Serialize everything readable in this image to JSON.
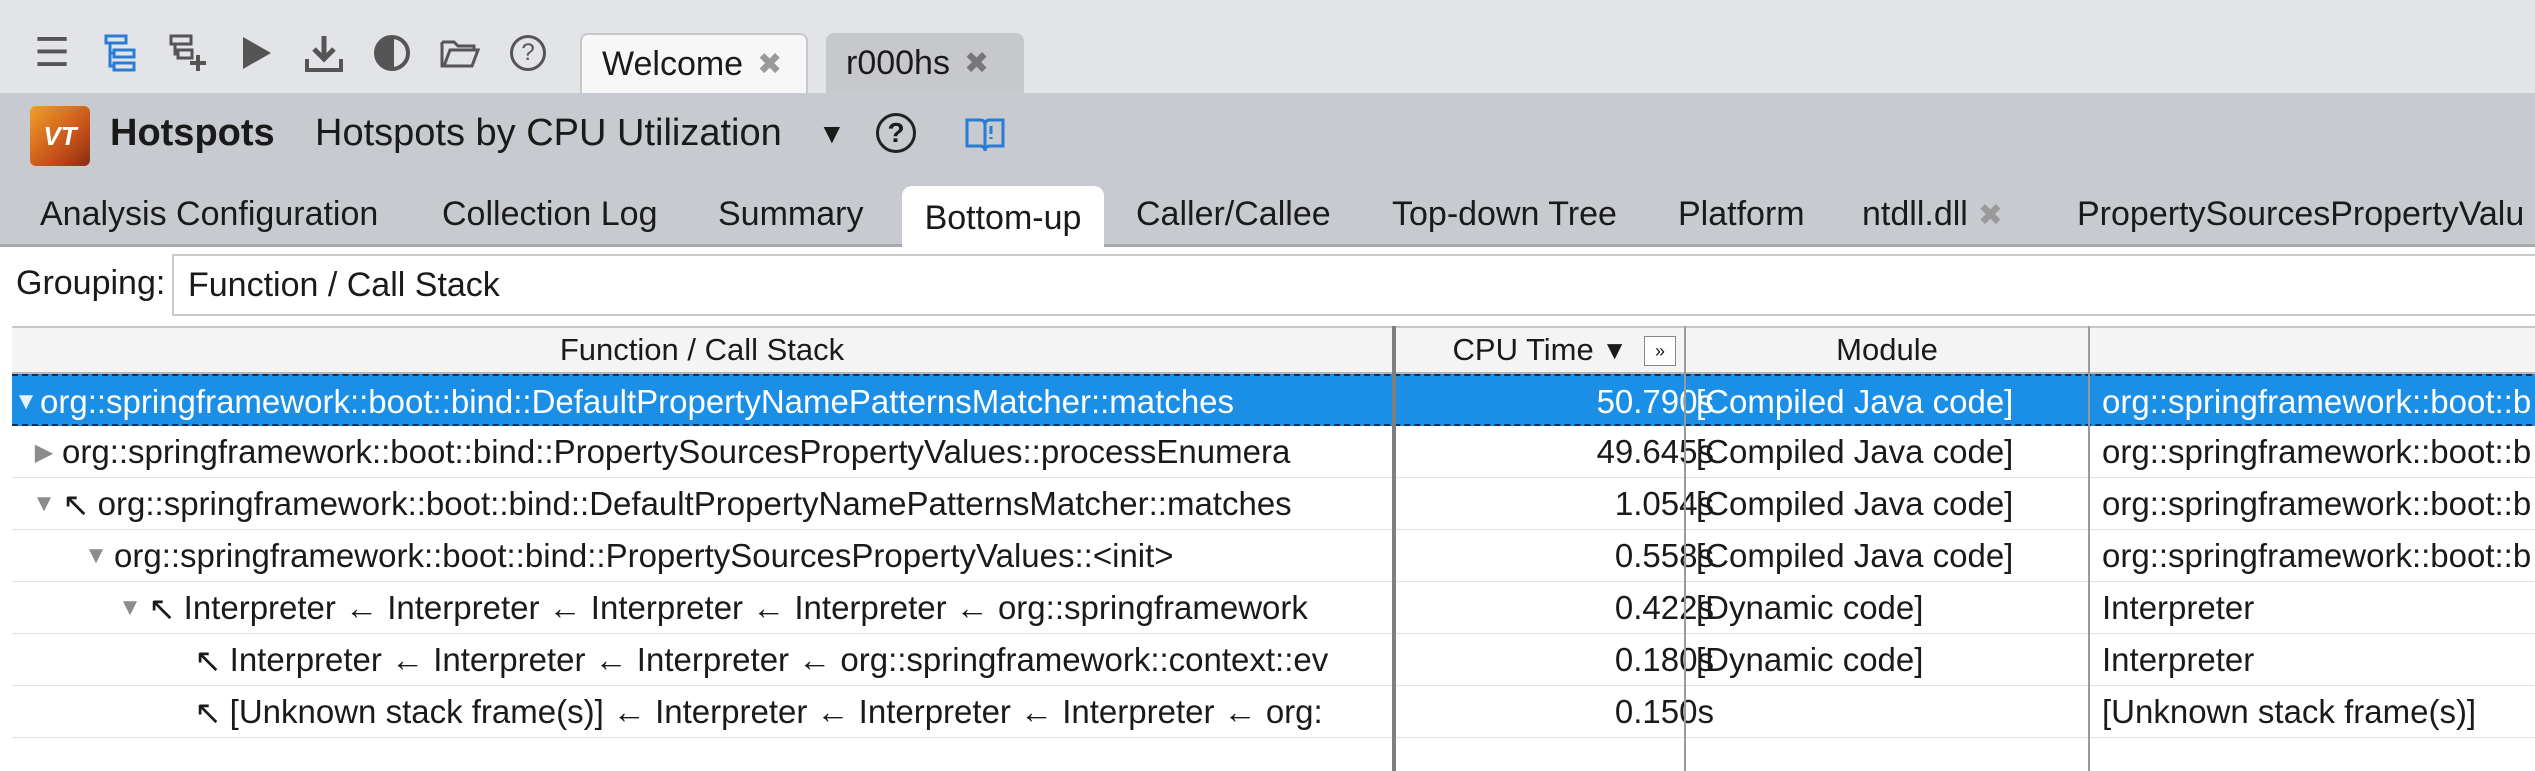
{
  "toolbar": {
    "icons": [
      "menu-icon",
      "hierarchy-icon",
      "new-analysis-icon",
      "play-icon",
      "download-icon",
      "compare-icon",
      "open-folder-icon",
      "help-icon"
    ]
  },
  "tabs": [
    {
      "label": "Welcome"
    },
    {
      "label": "r000hs"
    }
  ],
  "header": {
    "title": "Hotspots",
    "viewpoint": "Hotspots by CPU Utilization",
    "logo": "VT"
  },
  "analysis_tabs": [
    {
      "label": "Analysis Configuration"
    },
    {
      "label": "Collection Log"
    },
    {
      "label": "Summary"
    },
    {
      "label": "Bottom-up"
    },
    {
      "label": "Caller/Callee"
    },
    {
      "label": "Top-down Tree"
    },
    {
      "label": "Platform"
    },
    {
      "label": "ntdll.dll"
    },
    {
      "label": "PropertySourcesPropertyValu"
    }
  ],
  "grouping": {
    "label": "Grouping:",
    "value": "Function / Call Stack"
  },
  "grid": {
    "columns": [
      "Function / Call Stack",
      "CPU Time",
      "Module",
      ""
    ],
    "rows": [
      {
        "fn": "org::springframework::boot::bind::DefaultPropertyNamePatternsMatcher::matches",
        "cpu": "50.790s",
        "module": "[Compiled Java code]",
        "last": "org::springframework::boot::b"
      },
      {
        "fn": "org::springframework::boot::bind::PropertySourcesPropertyValues::processEnumera",
        "cpu": "49.645s",
        "module": "[Compiled Java code]",
        "last": "org::springframework::boot::b"
      },
      {
        "fn": "org::springframework::boot::bind::DefaultPropertyNamePatternsMatcher::matches",
        "cpu": "1.054s",
        "module": "[Compiled Java code]",
        "last": "org::springframework::boot::b"
      },
      {
        "fn": "org::springframework::boot::bind::PropertySourcesPropertyValues::<init>",
        "cpu": "0.558s",
        "module": "[Compiled Java code]",
        "last": "org::springframework::boot::b"
      },
      {
        "fn": "Interpreter ← Interpreter ← Interpreter ← Interpreter ← org::springframework",
        "cpu": "0.422s",
        "module": "[Dynamic code]",
        "last": "Interpreter"
      },
      {
        "fn": "Interpreter ← Interpreter ← Interpreter ← org::springframework::context::ev",
        "cpu": "0.180s",
        "module": "[Dynamic code]",
        "last": "Interpreter"
      },
      {
        "fn": "[Unknown stack frame(s)] ← Interpreter ← Interpreter ← Interpreter ← org:",
        "cpu": "0.150s",
        "module": "",
        "last": "[Unknown stack frame(s)]"
      }
    ]
  },
  "colors": {
    "selection": "#1b8ee6",
    "header_bg": "#c7cacf",
    "accent": "#2a7bd4"
  }
}
